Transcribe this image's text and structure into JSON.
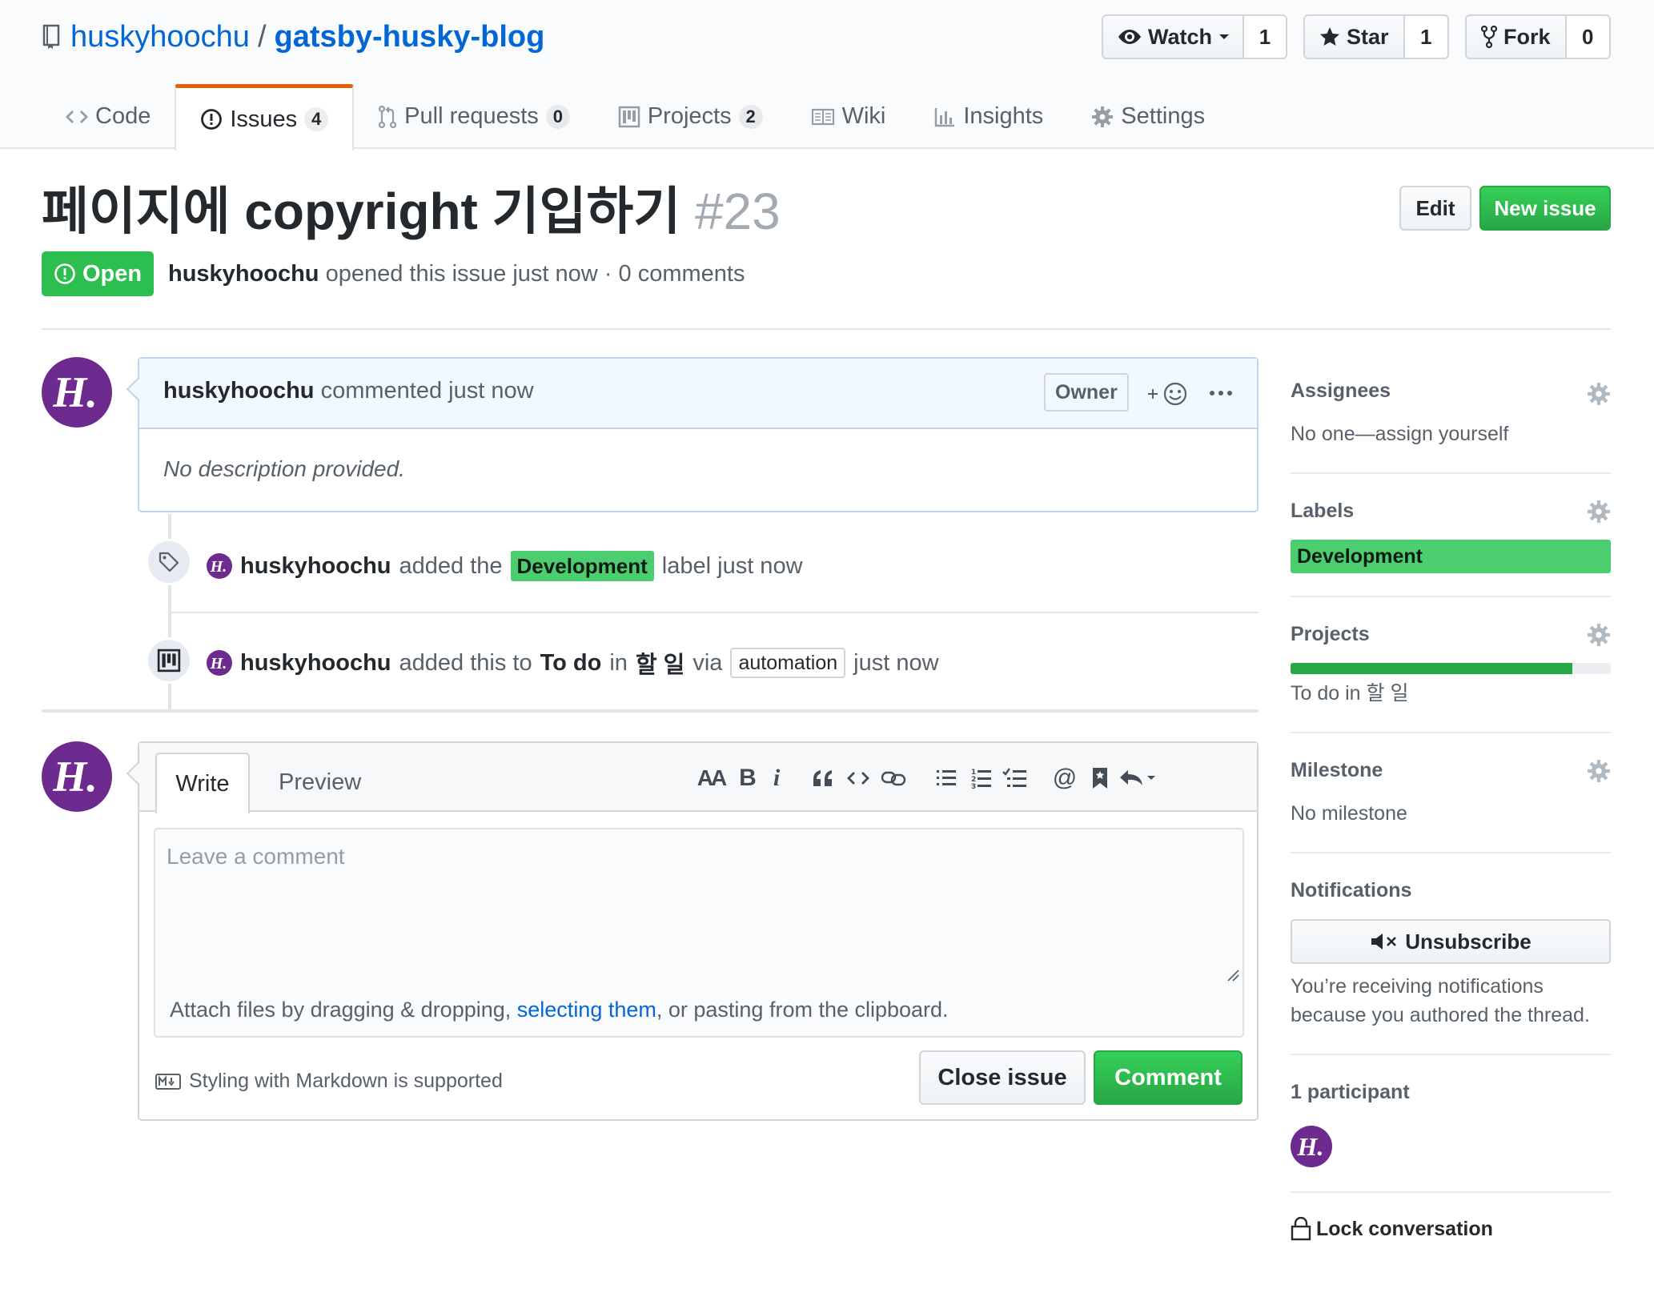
{
  "repo": {
    "owner": "huskyhoochu",
    "separator": "/",
    "name": "gatsby-husky-blog"
  },
  "actions": {
    "watch": {
      "label": "Watch",
      "count": "1"
    },
    "star": {
      "label": "Star",
      "count": "1"
    },
    "fork": {
      "label": "Fork",
      "count": "0"
    }
  },
  "nav": {
    "code": "Code",
    "issues": "Issues",
    "issues_count": "4",
    "pulls": "Pull requests",
    "pulls_count": "0",
    "projects": "Projects",
    "projects_count": "2",
    "wiki": "Wiki",
    "insights": "Insights",
    "settings": "Settings"
  },
  "issue": {
    "title": "페이지에 copyright 기입하기",
    "number": "#23",
    "state": "Open",
    "author": "huskyhoochu",
    "meta": "opened this issue just now · 0 comments",
    "edit_label": "Edit",
    "new_issue_label": "New issue"
  },
  "comment": {
    "author": "huskyhoochu",
    "action": "commented just now",
    "badge": "Owner",
    "body": "No description provided."
  },
  "timeline": {
    "label_event": {
      "author": "huskyhoochu",
      "before": "added the",
      "label": "Development",
      "after": "label just now"
    },
    "project_event": {
      "author": "huskyhoochu",
      "before": "added this to",
      "column": "To do",
      "in": "in",
      "project": "할 일",
      "via": "via",
      "tag": "automation",
      "after": "just now"
    }
  },
  "form": {
    "tab_write": "Write",
    "tab_preview": "Preview",
    "toolbar_heading": "AA",
    "toolbar_bold": "B",
    "toolbar_italic": "i",
    "toolbar_quote": "66",
    "toolbar_mention": "@",
    "placeholder": "Leave a comment",
    "attach_before": "Attach files by dragging & dropping, ",
    "attach_link": "selecting them",
    "attach_after": ", or pasting from the clipboard.",
    "markdown_note": "Styling with Markdown is supported",
    "close_label": "Close issue",
    "comment_label": "Comment"
  },
  "sidebar": {
    "assignees_heading": "Assignees",
    "assignees_value": "No one—assign yourself",
    "labels_heading": "Labels",
    "label": "Development",
    "projects_heading": "Projects",
    "project_progress_percent": 88,
    "project_value": "To do in 할 일",
    "milestone_heading": "Milestone",
    "milestone_value": "No milestone",
    "notifications_heading": "Notifications",
    "unsubscribe_label": "Unsubscribe",
    "notifications_reason_1": "You’re receiving notifications",
    "notifications_reason_2": "because you authored the thread.",
    "participants_heading": "1 participant",
    "lock_label": "Lock conversation"
  },
  "colors": {
    "link": "#0366d6",
    "green": "#28a745",
    "label_green": "#4ccd6f",
    "avatar_purple": "#6e2b8f",
    "tab_accent": "#e36209"
  }
}
